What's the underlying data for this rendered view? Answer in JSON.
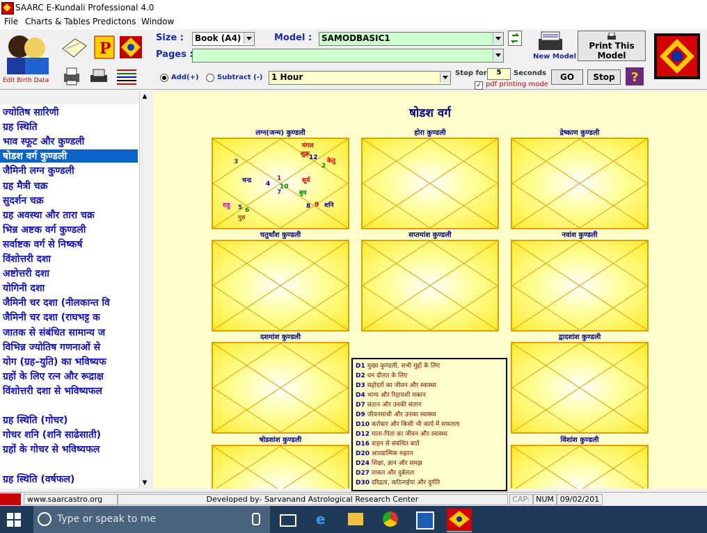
{
  "window": {
    "title": "SAARC E-Kundali Professional 4.0"
  },
  "menu": [
    "File",
    "Charts & Tables",
    "Predictons",
    "Window"
  ],
  "toolbar": {
    "edit_birth_label": "Edit Birth Data",
    "size_label": "Size :",
    "size_value": "Book (A4)",
    "model_label": "Model :",
    "model_value": "SAMODBASIC1",
    "pages_label": "Pages :",
    "pages_value": "",
    "new_model_label": "New Model",
    "print_model_label": "Print This Model",
    "add_label": "Add(+)",
    "subtract_label": "Subtract (-)",
    "interval_value": "1 Hour",
    "stop_for_label": "Stop for",
    "stop_for_value": "5",
    "seconds_label": "Seconds",
    "pdf_label": "pdf printing mode",
    "go_label": "GO",
    "stop_label": "Stop"
  },
  "sidebar": {
    "items": [
      {
        "label": "ज्योतिष सारिणी"
      },
      {
        "label": "ग्रह स्थिति"
      },
      {
        "label": "भाव स्फूट और कुण्डली"
      },
      {
        "label": "षोडश वर्ग कुण्डली"
      },
      {
        "label": "जैमिनी लग्न कुण्डली"
      },
      {
        "label": "ग्रह मैत्री चक्र"
      },
      {
        "label": "सुदर्शन चक्र"
      },
      {
        "label": "ग्रह अवस्था और तारा चक्र"
      },
      {
        "label": "भिन्न अष्टक वर्ग कुण्डली"
      },
      {
        "label": "सर्वाष्टक वर्ग से निष्कर्ष"
      },
      {
        "label": "विंशोत्तरी दशा"
      },
      {
        "label": "अष्टोत्तरी दशा"
      },
      {
        "label": "योगिनी दशा"
      },
      {
        "label": "जैमिनी चर दशा (नीलकान्त वि"
      },
      {
        "label": "जैमिनी चर दशा (राघभट्ट क"
      },
      {
        "label": "जातक से संबंधित सामान्य ज"
      },
      {
        "label": "विभिन्न ज्योतिष गणनाओं से"
      },
      {
        "label": "योग (ग्रह–युति) का भविष्यफ"
      },
      {
        "label": "ग्रहों के लिए रत्न और रूद्राक्ष"
      },
      {
        "label": "विंशोत्तरी दशा से भविष्यफल"
      },
      {
        "label": ""
      },
      {
        "label": "ग्रह स्थिति (गोचर)"
      },
      {
        "label": "गोचर शनि (शनि साढेसाती)"
      },
      {
        "label": "ग्रहों के गोचर से भविष्यफल"
      },
      {
        "label": ""
      },
      {
        "label": "ग्रह स्थिति (वर्षफल)"
      }
    ],
    "selected_index": 3
  },
  "main": {
    "heading": "षोडश वर्ग",
    "charts": [
      {
        "title": "लग्न(जन्म) कुण्डली"
      },
      {
        "title": "होरा कुण्डली"
      },
      {
        "title": "द्रेष्काण कुण्डली"
      },
      {
        "title": "चतुर्थांश कुण्डली"
      },
      {
        "title": "सप्तमांश कुण्डली"
      },
      {
        "title": "नवांश कुण्डली"
      },
      {
        "title": "दशमांश कुण्डली"
      },
      {
        "title": "द्वादशांश कुण्डली"
      },
      {
        "title": "षोडशांश कुण्डली"
      },
      {
        "title": "विंशांश कुण्डली"
      }
    ],
    "chart1_marks": [
      {
        "t": "मंगल",
        "c": "#c00000"
      },
      {
        "t": "शुक्र",
        "c": "#c00000"
      },
      {
        "t": "केतु",
        "c": "#c00000"
      },
      {
        "t": "3",
        "c": "#333"
      },
      {
        "t": "12",
        "c": "#000080"
      },
      {
        "t": "2",
        "c": "#008000"
      },
      {
        "t": "चन्द्र",
        "c": "#000080"
      },
      {
        "t": "1",
        "c": "#c00000"
      },
      {
        "t": "4",
        "c": "#000080"
      },
      {
        "t": "सूर्य",
        "c": "#c00000"
      },
      {
        "t": "10",
        "c": "#008000"
      },
      {
        "t": "7",
        "c": "#333"
      },
      {
        "t": "बुध",
        "c": "#008000"
      },
      {
        "t": "राहु",
        "c": "#c000c0"
      },
      {
        "t": "5",
        "c": "#333"
      },
      {
        "t": "6",
        "c": "#008000"
      },
      {
        "t": "गुरु",
        "c": "#8b4513"
      },
      {
        "t": "8",
        "c": "#000080"
      },
      {
        "t": "9",
        "c": "#c00000"
      },
      {
        "t": "शनि",
        "c": "#000080"
      }
    ],
    "legend": [
      {
        "code": "D1",
        "text": "मुख्य कुण्डली, सभी मुद्दों के लिए"
      },
      {
        "code": "D2",
        "text": "धन दौलत के लिए"
      },
      {
        "code": "D3",
        "text": "सहोदरों का जीवन और स्वास्थ्य"
      },
      {
        "code": "D4",
        "text": "भाग्य और रिहायशी मकान"
      },
      {
        "code": "D7",
        "text": "संतान और उनकी संतान"
      },
      {
        "code": "D9",
        "text": "जीवनसाथी और उनका स्वास्थ्य"
      },
      {
        "code": "D10",
        "text": "करोबार और किसी भी कार्य में सफलता"
      },
      {
        "code": "D12",
        "text": "माता-पिता का जीवन और स्वास्थ्य"
      },
      {
        "code": "D16",
        "text": "वाहन से संबंधित बातें"
      },
      {
        "code": "D20",
        "text": "आध्यात्मिक रुझान"
      },
      {
        "code": "D24",
        "text": "शिक्षा, ज्ञान और समझ"
      },
      {
        "code": "D27",
        "text": "ताकत और दुर्बलता"
      },
      {
        "code": "D30",
        "text": "दरिद्रता, कठिनाईयां और दुर्गति"
      }
    ]
  },
  "status": {
    "website": "www.saarcastro.org",
    "developer": "Developed by- Sarvanand Astrological Research Center",
    "cap": "CAP:",
    "num": "NUM",
    "date": "09/02/201"
  },
  "taskbar": {
    "search_placeholder": "Type or speak to me"
  },
  "colors": {
    "main_bg": "#ffffcc",
    "chart_border": "#e0a000",
    "sidebar_text": "#1414b4",
    "selected_bg": "#0a64c8"
  }
}
